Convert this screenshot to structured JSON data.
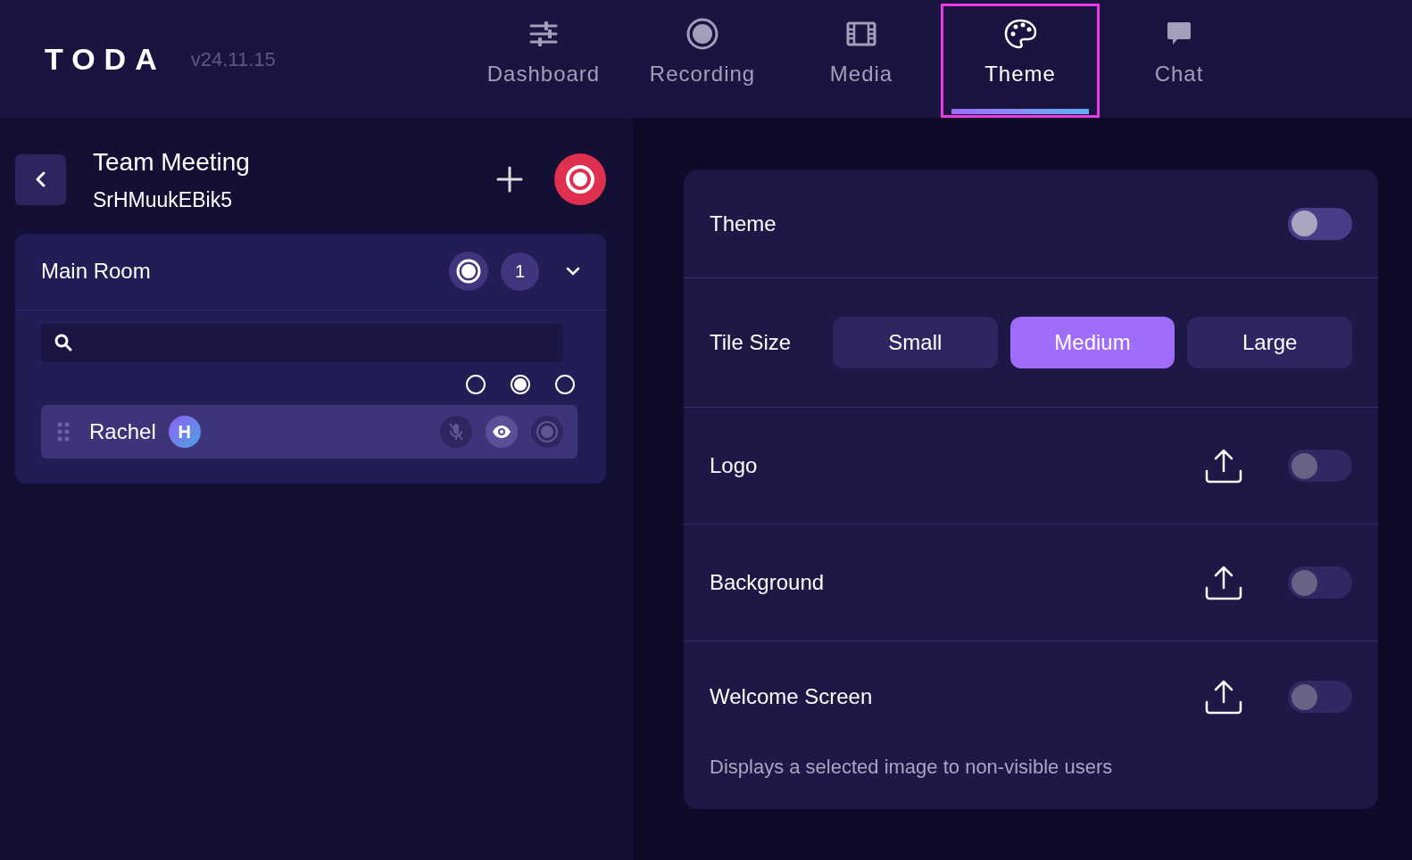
{
  "header": {
    "logo": "TODA",
    "version": "v24.11.15"
  },
  "tabs": [
    {
      "kind": "sliders",
      "label": "Dashboard",
      "selected": false,
      "highlighted": false
    },
    {
      "kind": "record",
      "label": "Recording",
      "selected": false,
      "highlighted": false
    },
    {
      "kind": "film",
      "label": "Media",
      "selected": false,
      "highlighted": false
    },
    {
      "kind": "palette",
      "label": "Theme",
      "selected": true,
      "highlighted": true
    },
    {
      "kind": "chat",
      "label": "Chat",
      "selected": false,
      "highlighted": false
    }
  ],
  "meeting": {
    "title": "Team Meeting",
    "code": "SrHMuukEBik5"
  },
  "room": {
    "name": "Main Room",
    "count": "1",
    "expanded": true,
    "filters": [
      {
        "selected": false
      },
      {
        "selected": true
      },
      {
        "selected": false
      }
    ],
    "participants": [
      {
        "name": "Rachel",
        "badge": "H",
        "mic_on": false,
        "visible": true,
        "recording": false
      }
    ]
  },
  "settings": [
    {
      "kind": "toggle",
      "label": "Theme",
      "on": false,
      "disabled": false
    },
    {
      "kind": "choice",
      "label": "Tile Size",
      "options": [
        {
          "label": "Small",
          "selected": false
        },
        {
          "label": "Medium",
          "selected": true
        },
        {
          "label": "Large",
          "selected": false
        }
      ]
    },
    {
      "kind": "upload",
      "label": "Logo",
      "on": false,
      "disabled": true
    },
    {
      "kind": "upload",
      "label": "Background",
      "on": false,
      "disabled": true
    },
    {
      "kind": "upload",
      "label": "Welcome Screen",
      "on": false,
      "disabled": true,
      "note": "Displays a selected image to non-visible users"
    }
  ]
}
